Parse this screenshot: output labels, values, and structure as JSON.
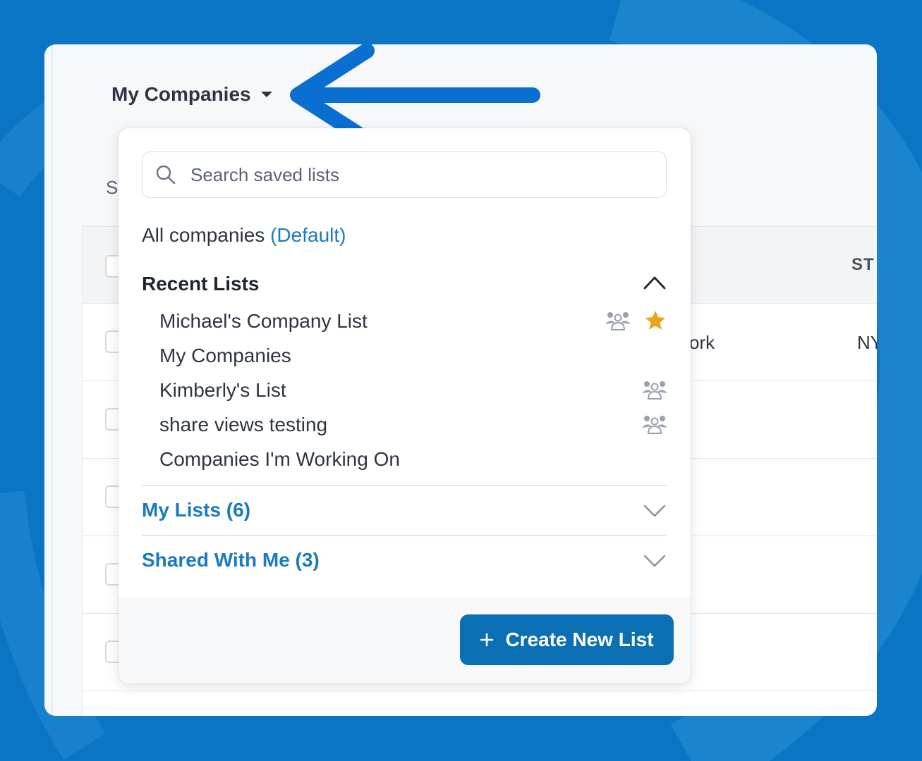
{
  "page": {
    "list_selector": {
      "label": "My Companies",
      "icon": "caret-down-icon"
    },
    "partial_heading_letter": "S",
    "table": {
      "partial_state_header": "ST",
      "partial_city_cell": "ork",
      "partial_state_cell": "NY",
      "row_count": 5
    }
  },
  "dropdown": {
    "search": {
      "placeholder": "Search saved lists",
      "value": "",
      "icon": "search-icon"
    },
    "all_companies": {
      "label": "All companies",
      "default_tag": "(Default)"
    },
    "recent": {
      "title": "Recent Lists",
      "expanded": true,
      "items": [
        {
          "label": "Michael's Company List",
          "shared": true,
          "starred": true
        },
        {
          "label": "My Companies",
          "shared": false,
          "starred": false
        },
        {
          "label": "Kimberly's List",
          "shared": true,
          "starred": false
        },
        {
          "label": "share views testing",
          "shared": true,
          "starred": false
        },
        {
          "label": "Companies I'm Working On",
          "shared": false,
          "starred": false
        }
      ]
    },
    "my_lists": {
      "label": "My Lists (6)",
      "expanded": false
    },
    "shared_with_me": {
      "label": "Shared With Me (3)",
      "expanded": false
    },
    "create_button": {
      "label": "Create New List",
      "icon": "plus-icon"
    }
  },
  "colors": {
    "background_blue": "#0a75c4",
    "link_blue": "#1a7bbd",
    "button_blue": "#0b6fb3",
    "star_gold": "#eaa41c",
    "arrow_blue": "#0a6fd0"
  }
}
